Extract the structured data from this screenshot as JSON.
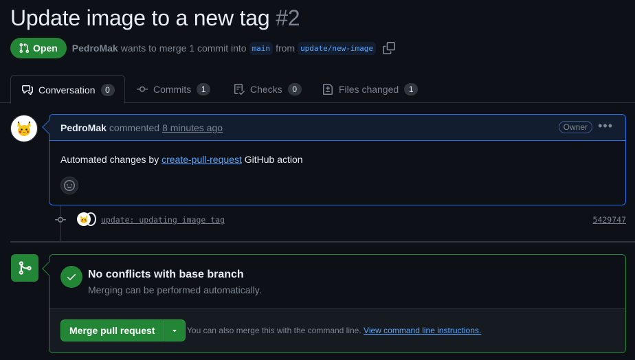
{
  "pr": {
    "title": "Update image to a new tag",
    "number": "#2",
    "state": "Open",
    "author": "PedroMak",
    "merge_text": "wants to merge 1 commit into",
    "base_branch": "main",
    "from_text": "from",
    "head_branch": "update/new-image"
  },
  "tabs": [
    {
      "label": "Conversation",
      "count": "0",
      "icon": "comment-discussion-icon"
    },
    {
      "label": "Commits",
      "count": "1",
      "icon": "git-commit-icon"
    },
    {
      "label": "Checks",
      "count": "0",
      "icon": "checklist-icon"
    },
    {
      "label": "Files changed",
      "count": "1",
      "icon": "file-diff-icon"
    }
  ],
  "comment": {
    "author": "PedroMak",
    "verb": "commented",
    "time": "8 minutes ago",
    "role": "Owner",
    "body_before": "Automated changes by",
    "body_link": "create-pull-request",
    "body_after": "GitHub action"
  },
  "commit": {
    "message": "update: updating image tag",
    "sha": "5429747"
  },
  "merge": {
    "heading": "No conflicts with base branch",
    "subtext": "Merging can be performed automatically.",
    "button": "Merge pull request",
    "hint": "You can also merge this with the command line.",
    "hint_link": "View command line instructions."
  },
  "colors": {
    "accent_green": "#238636",
    "accent_blue": "#1f6feb",
    "link": "#58a6ff",
    "bg": "#0d1117"
  }
}
